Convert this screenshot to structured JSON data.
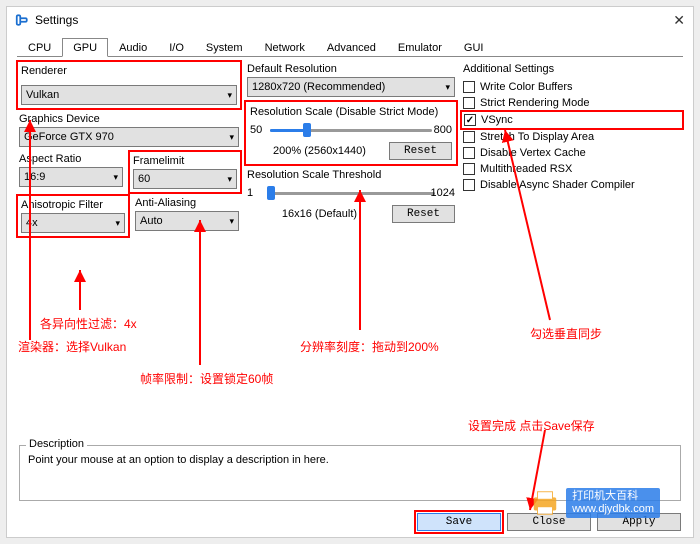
{
  "window": {
    "title": "Settings"
  },
  "tabs": [
    "CPU",
    "GPU",
    "Audio",
    "I/O",
    "System",
    "Network",
    "Advanced",
    "Emulator",
    "GUI"
  ],
  "active_tab": 1,
  "renderer": {
    "label": "Renderer",
    "value": "Vulkan"
  },
  "graphics_device": {
    "label": "Graphics Device",
    "value": "GeForce GTX 970"
  },
  "aspect_ratio": {
    "label": "Aspect Ratio",
    "value": "16:9"
  },
  "framelimit": {
    "label": "Framelimit",
    "value": "60"
  },
  "aniso": {
    "label": "Anisotropic Filter",
    "value": "4x"
  },
  "aa": {
    "label": "Anti-Aliasing",
    "value": "Auto"
  },
  "default_res": {
    "label": "Default Resolution",
    "value": "1280x720 (Recommended)"
  },
  "res_scale": {
    "label": "Resolution Scale (Disable Strict Mode)",
    "min": "50",
    "max": "800",
    "value": "200% (2560x1440)",
    "reset": "Reset"
  },
  "res_thresh": {
    "label": "Resolution Scale Threshold",
    "min": "1",
    "max": "1024",
    "value": "16x16 (Default)",
    "reset": "Reset"
  },
  "additional": {
    "label": "Additional Settings",
    "items": [
      {
        "label": "Write Color Buffers",
        "checked": false
      },
      {
        "label": "Strict Rendering Mode",
        "checked": false
      },
      {
        "label": "VSync",
        "checked": true
      },
      {
        "label": "Stretch To Display Area",
        "checked": false
      },
      {
        "label": "Disable Vertex Cache",
        "checked": false
      },
      {
        "label": "Multithreaded RSX",
        "checked": false
      },
      {
        "label": "Disable Async Shader Compiler",
        "checked": false
      }
    ]
  },
  "description": {
    "label": "Description",
    "text": "Point your mouse at an option to display a description in here."
  },
  "footer": {
    "save": "Save",
    "close": "Close",
    "apply": "Apply"
  },
  "anno": {
    "aniso": "各异向性过滤：4x",
    "renderer": "渲染器：选择Vulkan",
    "framelimit": "帧率限制：设置锁定60帧",
    "resscale": "分辨率刻度：拖动到200%",
    "vsync": "勾选垂直同步",
    "save": "设置完成 点击Save保存"
  },
  "watermark": {
    "line1": "打印机大百科",
    "line2": "www.djydbk.com"
  }
}
